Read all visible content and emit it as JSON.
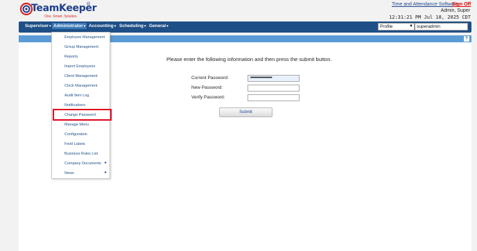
{
  "brand": {
    "name": "TeamKeeper",
    "registered": "®",
    "tagline": "One. Smart. Solution."
  },
  "header": {
    "app_link": "Time and Attendance Software",
    "sign_off": "Sign Off",
    "user": "Admin, Super",
    "datetime": "12:31:21 PM Jul 18, 2025 CDT"
  },
  "nav": {
    "items": [
      {
        "label": "Supervisor"
      },
      {
        "label": "Administrator"
      },
      {
        "label": "Accounting"
      },
      {
        "label": "Scheduling"
      },
      {
        "label": "General"
      }
    ],
    "active": "Administrator",
    "profile_select": "Profile",
    "username_value": "superadmin"
  },
  "help": {
    "icon": "?"
  },
  "dropdown": {
    "items": [
      {
        "label": "Employee Management"
      },
      {
        "label": "Group Management"
      },
      {
        "label": "Reports"
      },
      {
        "label": "Import Employees"
      },
      {
        "label": "Client Management"
      },
      {
        "label": "Clock Management"
      },
      {
        "label": "Audit Item Log"
      },
      {
        "label": "Notifications"
      },
      {
        "label": "Change Password"
      },
      {
        "label": "Manage Menu"
      },
      {
        "label": "Configuration"
      },
      {
        "label": "Field Labels"
      },
      {
        "label": "Business Rules List"
      },
      {
        "label": "Company Documents"
      },
      {
        "label": "News"
      }
    ],
    "highlighted": "Change Password"
  },
  "form": {
    "instructions": "Please enter the following information and then press the submit button.",
    "current_password_label": "Current Password:",
    "current_password_value": "••••••••••••••••",
    "new_password_label": "New Password:",
    "verify_password_label": "Verify Password:",
    "submit_label": "Submit"
  },
  "colors": {
    "nav_bg": "#1e4f86",
    "sub_bar": "#5b9bd5",
    "sign_off": "#dd0000",
    "highlight": "#e0001b",
    "brand": "#1e3f8a"
  }
}
